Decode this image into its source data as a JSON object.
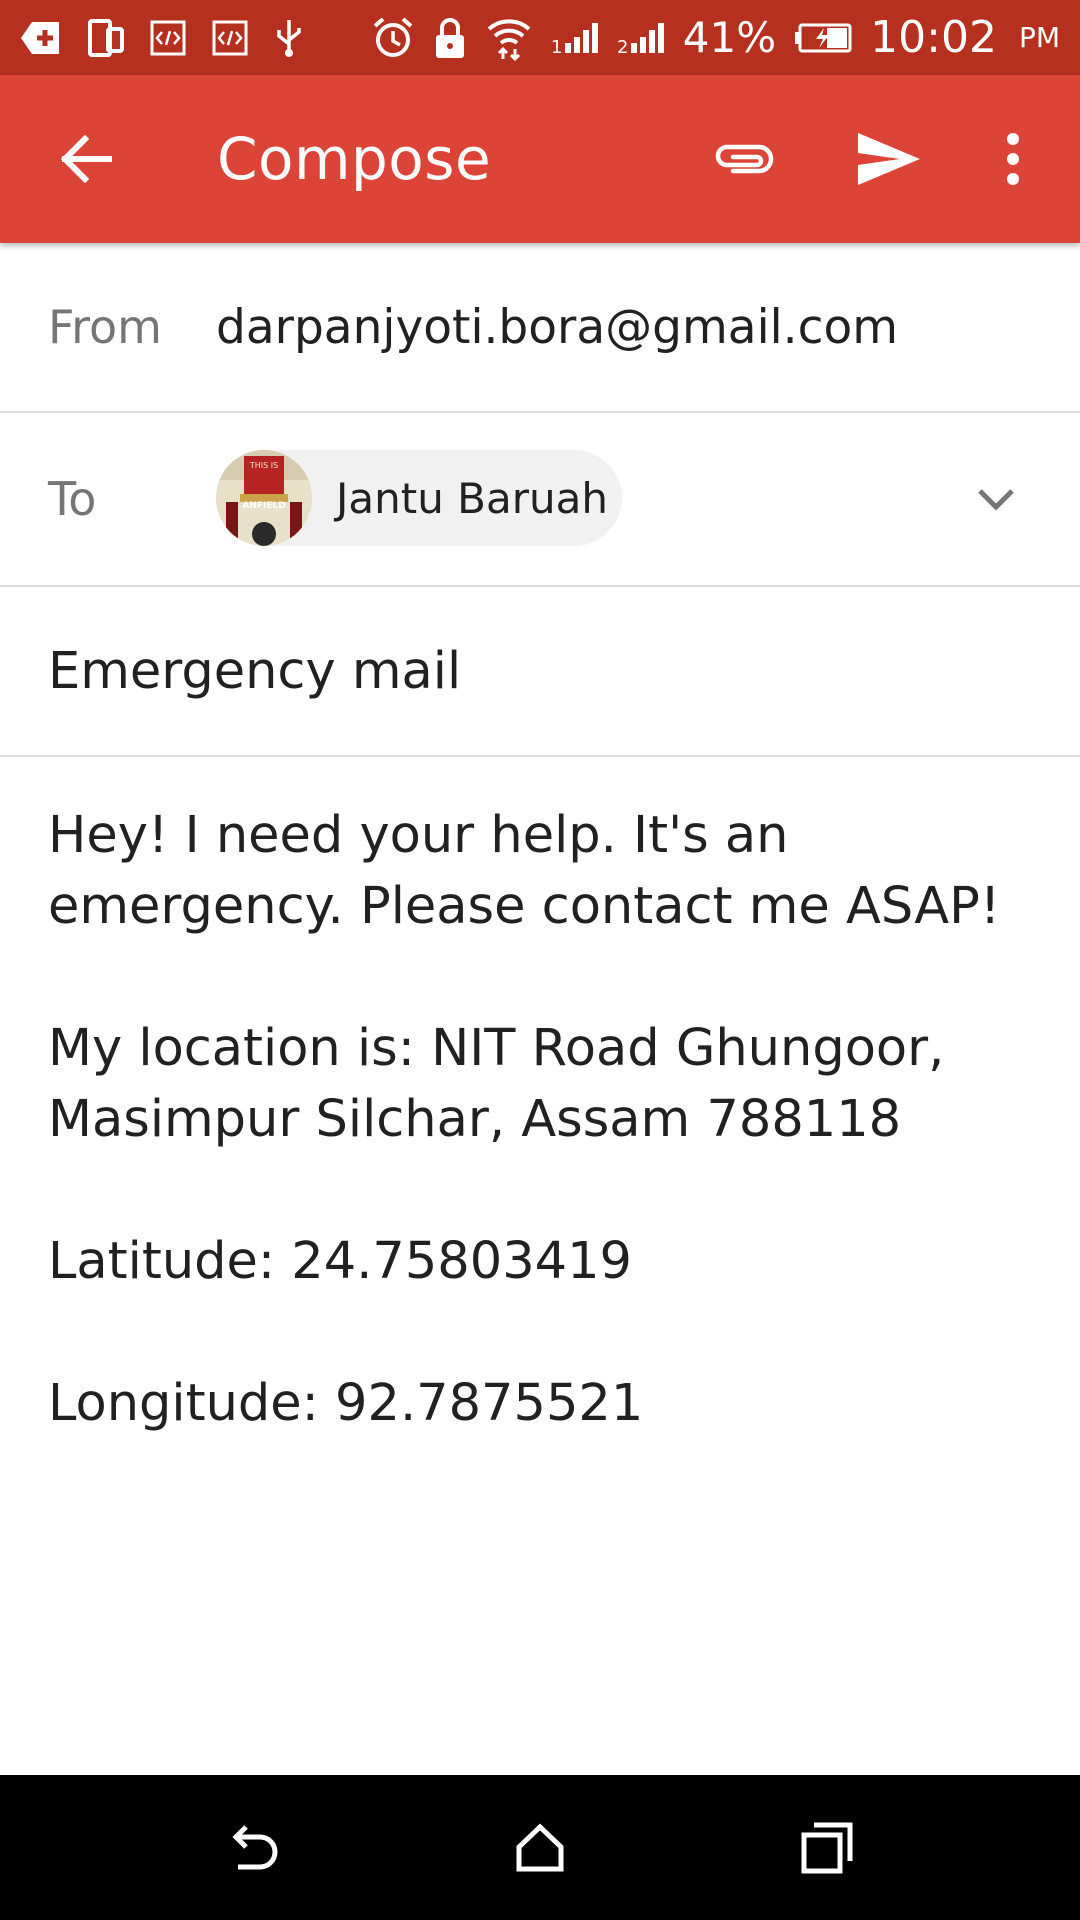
{
  "status_bar": {
    "battery_percent": "41%",
    "time": "10:02",
    "ampm": "PM",
    "icons": [
      "add-notification-icon",
      "device-rotate-icon",
      "code-icon",
      "code-icon",
      "usb-icon",
      "alarm-icon",
      "lock-icon",
      "wifi-icon",
      "signal-1-icon",
      "signal-2-icon",
      "battery-charging-icon"
    ]
  },
  "app_bar": {
    "title": "Compose",
    "color": "#db4437",
    "status_color": "#b5301f",
    "icons": [
      "back-arrow-icon",
      "attach-icon",
      "send-icon",
      "more-vert-icon"
    ]
  },
  "from": {
    "label": "From",
    "value": "darpanjyoti.bora@gmail.com"
  },
  "to": {
    "label": "To",
    "recipient": "Jantu Baruah",
    "avatar_text_top": "THIS IS",
    "avatar_text_bottom": "ANFIELD"
  },
  "subject": "Emergency mail",
  "body": {
    "line1": "Hey! I need your help. It's an emergency. Please contact me ASAP!",
    "line2": "My location is: NIT Road Ghungoor, Masimpur Silchar, Assam 788118",
    "line3": "Latitude: 24.75803419",
    "line4": "Longitude: 92.7875521"
  },
  "nav_bar": {
    "icons": [
      "nav-back-icon",
      "home-icon",
      "recents-icon"
    ]
  }
}
